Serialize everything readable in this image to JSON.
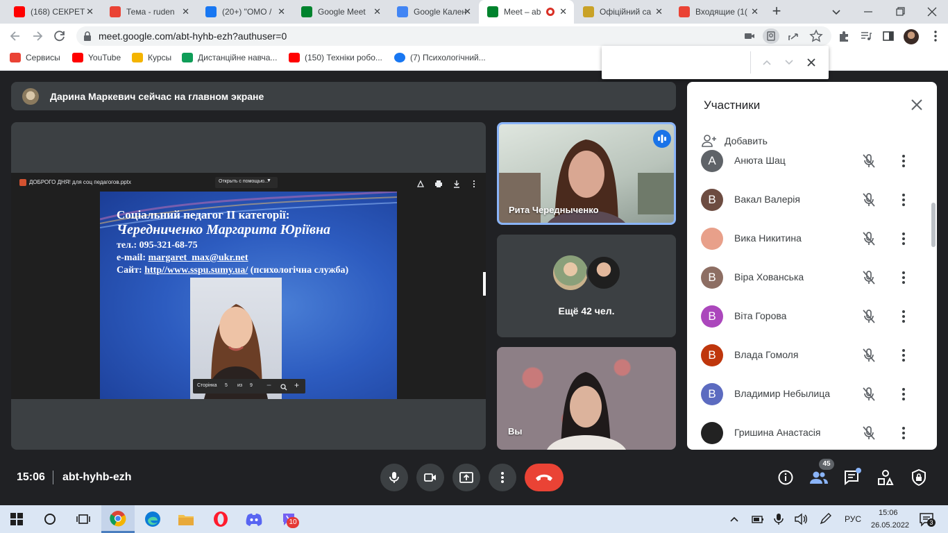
{
  "tabs": [
    {
      "title": "(168) СЕКРЕТ",
      "icon": "youtube-icon",
      "color": "#ff0000"
    },
    {
      "title": "Тема - ruden",
      "icon": "gmail-icon",
      "color": "#ea4335"
    },
    {
      "title": "(20+) \"ОМО /",
      "icon": "facebook-icon",
      "color": "#1877f2"
    },
    {
      "title": "Google Meet",
      "icon": "meet-icon",
      "color": "#00832d"
    },
    {
      "title": "Google Кален",
      "icon": "calendar-icon",
      "color": "#4285f4"
    },
    {
      "title": "Meet – ab",
      "icon": "meet-icon",
      "color": "#00832d",
      "active": true
    },
    {
      "title": "Офіційний са",
      "icon": "shield-icon",
      "color": "#c9a227"
    },
    {
      "title": "Входящие (1(",
      "icon": "gmail-icon",
      "color": "#ea4335"
    }
  ],
  "address": {
    "url": "meet.google.com/abt-hyhb-ezh?authuser=0"
  },
  "bookmarks": [
    {
      "label": "Сервисы",
      "icon": "apps-grid-icon"
    },
    {
      "label": "YouTube",
      "icon": "youtube-icon"
    },
    {
      "label": "Курсы",
      "icon": "classroom-icon"
    },
    {
      "label": "Дистанційне навча...",
      "icon": "sheets-icon"
    },
    {
      "label": "(150) Техніки робо...",
      "icon": "youtube-icon"
    },
    {
      "label": "(7) Психологічний...",
      "icon": "facebook-icon"
    }
  ],
  "find_bar": {
    "value": ""
  },
  "banner": {
    "text": "Дарина Маркевич сейчас на главном экране"
  },
  "presentation": {
    "file_name": "ДОБРОГО ДНЯ! для соц педагогов.pptx",
    "open_with": "Открыть с помощью...",
    "slide": {
      "line1": "Соціальний педагог ІІ категорії:",
      "line2": "Чередниченко Маргарита Юріївна",
      "phone": "тел.: 095-321-68-75",
      "email_label": "e-mail: ",
      "email": "margaret_max@ukr.net",
      "site_label": "Сайт: ",
      "site": "http//www.sspu.sumy.ua/",
      "site_note": " (психологічна служба)"
    },
    "pager": {
      "label": "Сторінка",
      "page": "5",
      "of": "из",
      "total": "9"
    }
  },
  "tiles": {
    "speaker": {
      "name": "Рита Чередныченко"
    },
    "more": {
      "text": "Ещё 42 чел."
    },
    "self": {
      "name": "Вы"
    }
  },
  "panel": {
    "title": "Участники",
    "add_label": "Добавить",
    "participants": [
      {
        "name": "Анюта Шац",
        "initial": "А",
        "color": "#5f6368"
      },
      {
        "name": "Вакал Валерія",
        "initial": "В",
        "color": "#6d4c41"
      },
      {
        "name": "Вика Никитина",
        "initial": "",
        "color": "#e8a08a"
      },
      {
        "name": "Віра Хованська",
        "initial": "В",
        "color": "#8d6e63"
      },
      {
        "name": "Віта Горова",
        "initial": "В",
        "color": "#ab47bc"
      },
      {
        "name": "Влада Гомоля",
        "initial": "В",
        "color": "#bf360c"
      },
      {
        "name": "Владимир Небылица",
        "initial": "В",
        "color": "#5c6bc0"
      },
      {
        "name": "Гришина Анастасія",
        "initial": "",
        "color": "#222222"
      }
    ]
  },
  "meeting": {
    "time": "15:06",
    "code": "abt-hyhb-ezh",
    "participants_count": "45"
  },
  "taskbar": {
    "lang": "РУС",
    "time": "15:06",
    "date": "26.05.2022",
    "notifications": "3",
    "viber_badge": "10"
  }
}
